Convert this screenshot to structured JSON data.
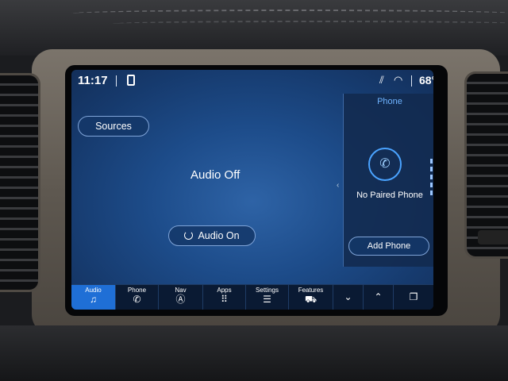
{
  "status_bar": {
    "time": "11:17",
    "temperature": "68°"
  },
  "main": {
    "sources_label": "Sources",
    "audio_status": "Audio Off",
    "audio_on_label": "Audio On"
  },
  "phone_panel": {
    "title": "Phone",
    "status": "No Paired Phone",
    "add_phone_label": "Add Phone"
  },
  "nav_bar": {
    "items": [
      {
        "label": "Audio",
        "icon": "music-note-icon",
        "active": true
      },
      {
        "label": "Phone",
        "icon": "phone-icon",
        "active": false
      },
      {
        "label": "Nav",
        "icon": "compass-icon",
        "active": false
      },
      {
        "label": "Apps",
        "icon": "grid-icon",
        "active": false
      },
      {
        "label": "Settings",
        "icon": "sliders-icon",
        "active": false
      },
      {
        "label": "Features",
        "icon": "car-icon",
        "active": false
      }
    ],
    "controls": [
      "chevron-down-icon",
      "chevron-up-icon",
      "copy-icon"
    ]
  },
  "colors": {
    "accent": "#1f6fd6",
    "phone_title": "#6fb3ff",
    "screen_bg": "#1d4c8a"
  }
}
